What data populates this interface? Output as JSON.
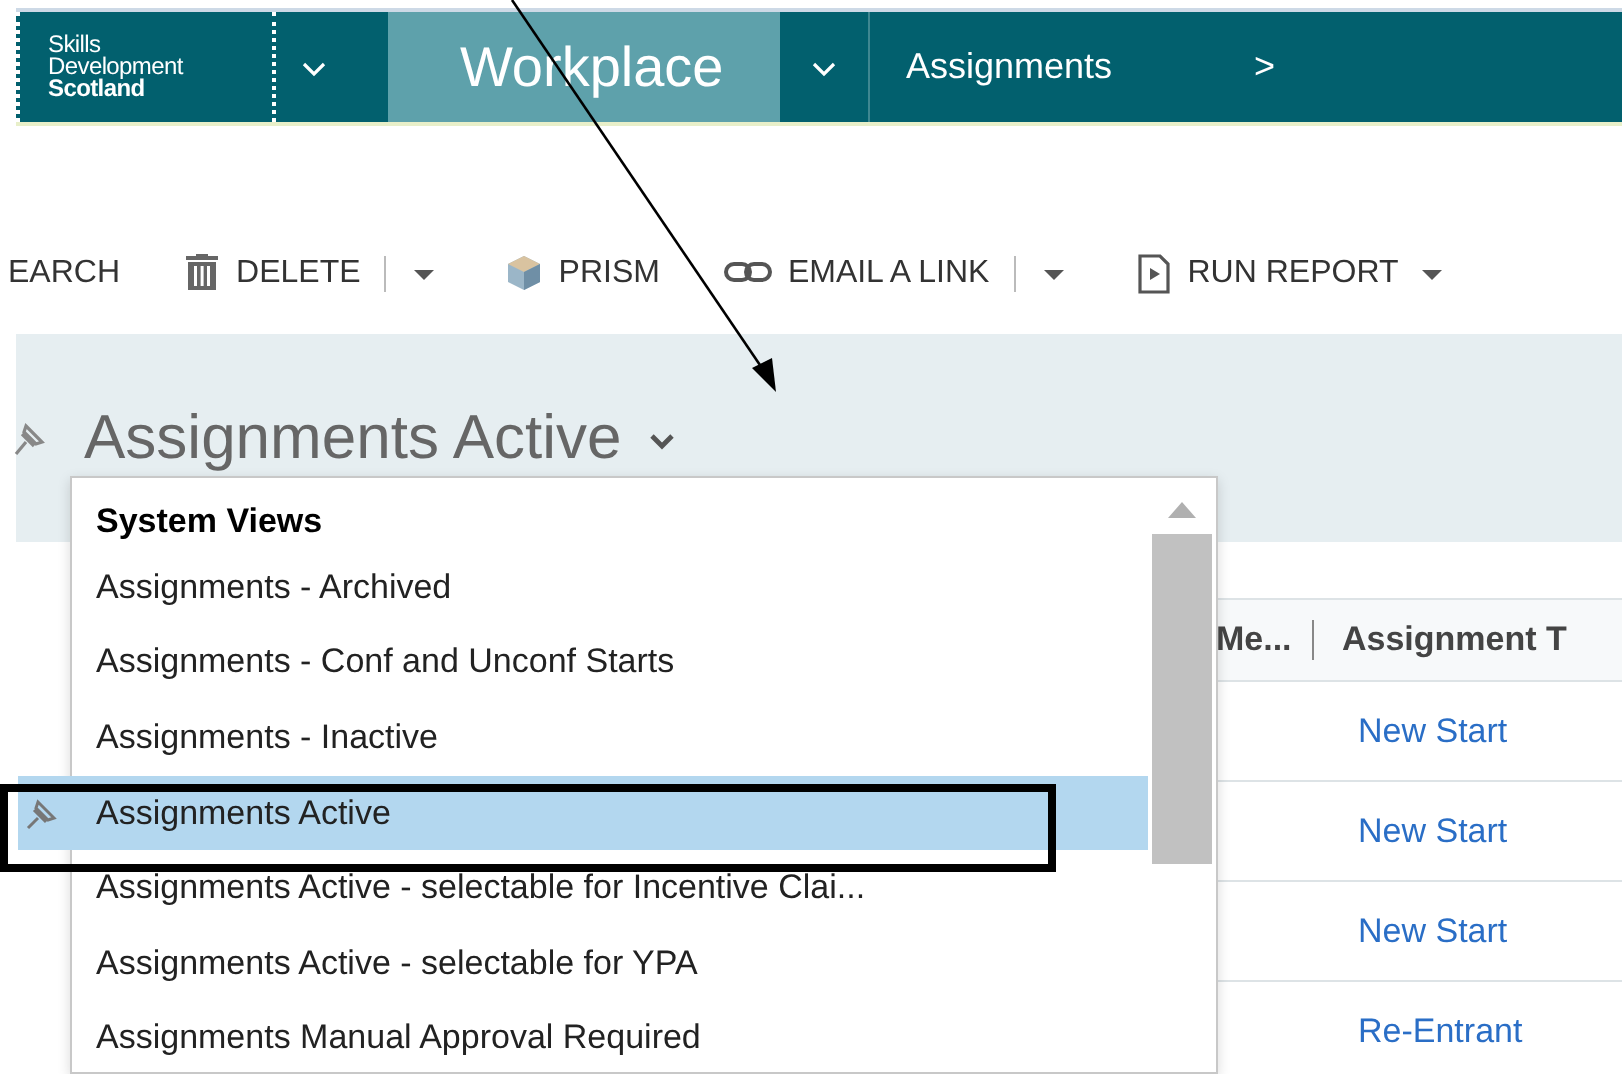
{
  "nav": {
    "logo_lines": [
      "Skills",
      "Development",
      "Scotland"
    ],
    "area": "Workplace",
    "breadcrumb": "Assignments",
    "breadcrumb_next": ">"
  },
  "toolbar": [
    {
      "label": "EARCH",
      "kind": "plain",
      "dropdown": false
    },
    {
      "label": "DELETE",
      "kind": "trash",
      "dropdown": true
    },
    {
      "label": "PRISM",
      "kind": "cube",
      "dropdown": false
    },
    {
      "label": "EMAIL A LINK",
      "kind": "link",
      "dropdown": true
    },
    {
      "label": "RUN REPORT",
      "kind": "report",
      "dropdown": true
    }
  ],
  "view": {
    "title": "Assignments Active",
    "pinned": true
  },
  "view_menu": {
    "heading": "System Views",
    "items": [
      {
        "label": "Assignments - Archived",
        "selected": false
      },
      {
        "label": "Assignments - Conf and Unconf Starts",
        "selected": false
      },
      {
        "label": "Assignments - Inactive",
        "selected": false
      },
      {
        "label": "Assignments Active",
        "selected": true
      },
      {
        "label": "Assignments Active - selectable for Incentive Clai...",
        "selected": false
      },
      {
        "label": "Assignments Active - selectable for YPA",
        "selected": false
      },
      {
        "label": "Assignments Manual Approval Required",
        "selected": false
      }
    ]
  },
  "grid": {
    "columns": [
      "Me...",
      "Assignment T"
    ],
    "rows": [
      "New Start",
      "New Start",
      "New Start",
      "Re-Entrant"
    ]
  }
}
